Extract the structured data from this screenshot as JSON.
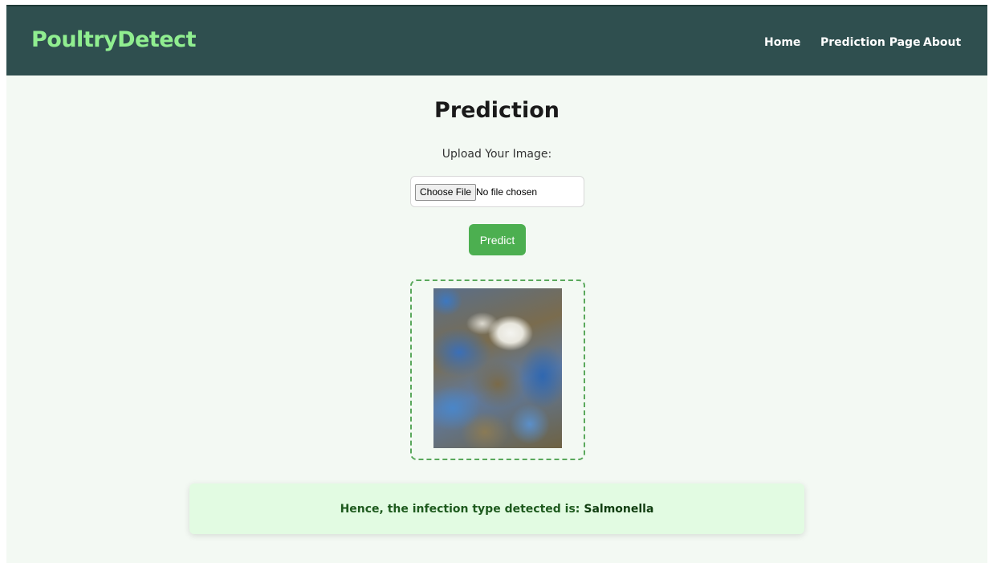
{
  "navbar": {
    "brand": "PoultryDetect",
    "links": [
      {
        "label": "Home"
      },
      {
        "label": "Prediction Page"
      },
      {
        "label": "About"
      }
    ]
  },
  "main": {
    "title": "Prediction",
    "upload_label": "Upload Your Image:",
    "file_input": {
      "button_label": "Choose File",
      "status": "No file chosen"
    },
    "predict_label": "Predict",
    "result": {
      "prefix": "Hence, the infection type detected is:",
      "value": "Salmonella"
    }
  },
  "colors": {
    "navbar_bg": "#2f4f4f",
    "brand": "#90ee90",
    "page_bg": "#f3f9f3",
    "predict_button": "#4caf50",
    "result_bg": "#e2fbe2",
    "dashed_border": "#5aa85c"
  }
}
